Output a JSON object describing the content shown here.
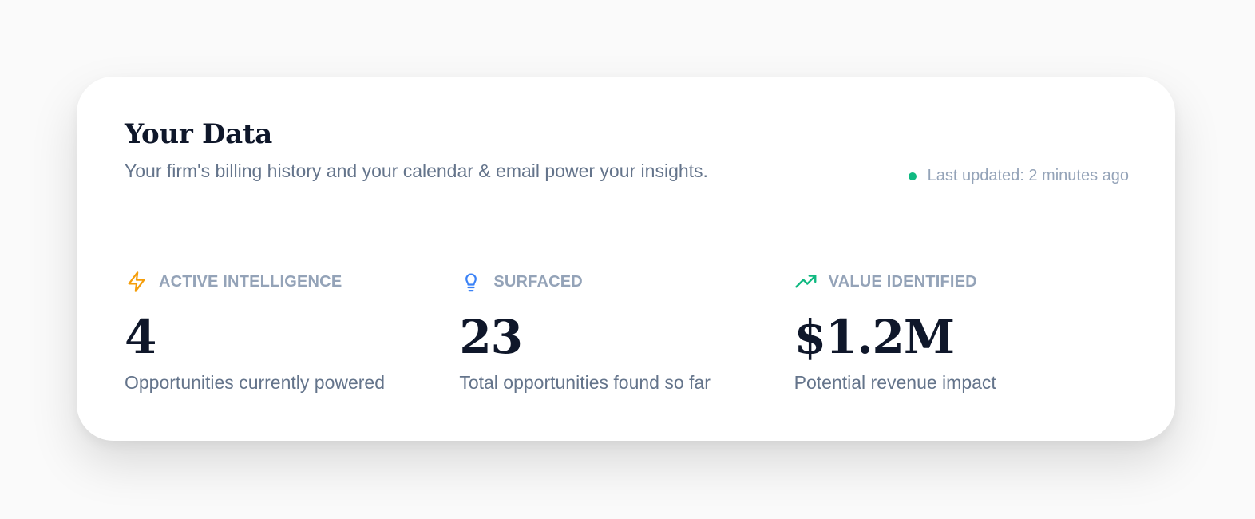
{
  "card": {
    "title": "Your Data",
    "subtitle": "Your firm's billing history and your calendar & email power your insights.",
    "status": {
      "text": "Last updated: 2 minutes ago",
      "dot_color": "#10b981"
    }
  },
  "stats": [
    {
      "icon": "lightning-bolt-icon",
      "icon_color": "#f59e0b",
      "label": "ACTIVE INTELLIGENCE",
      "value": "4",
      "description": "Opportunities currently powered"
    },
    {
      "icon": "lightbulb-icon",
      "icon_color": "#3b82f6",
      "label": "SURFACED",
      "value": "23",
      "description": "Total opportunities found so far"
    },
    {
      "icon": "trending-up-icon",
      "icon_color": "#10b981",
      "label": "VALUE IDENTIFIED",
      "value": "$1.2M",
      "description": "Potential revenue impact"
    }
  ]
}
